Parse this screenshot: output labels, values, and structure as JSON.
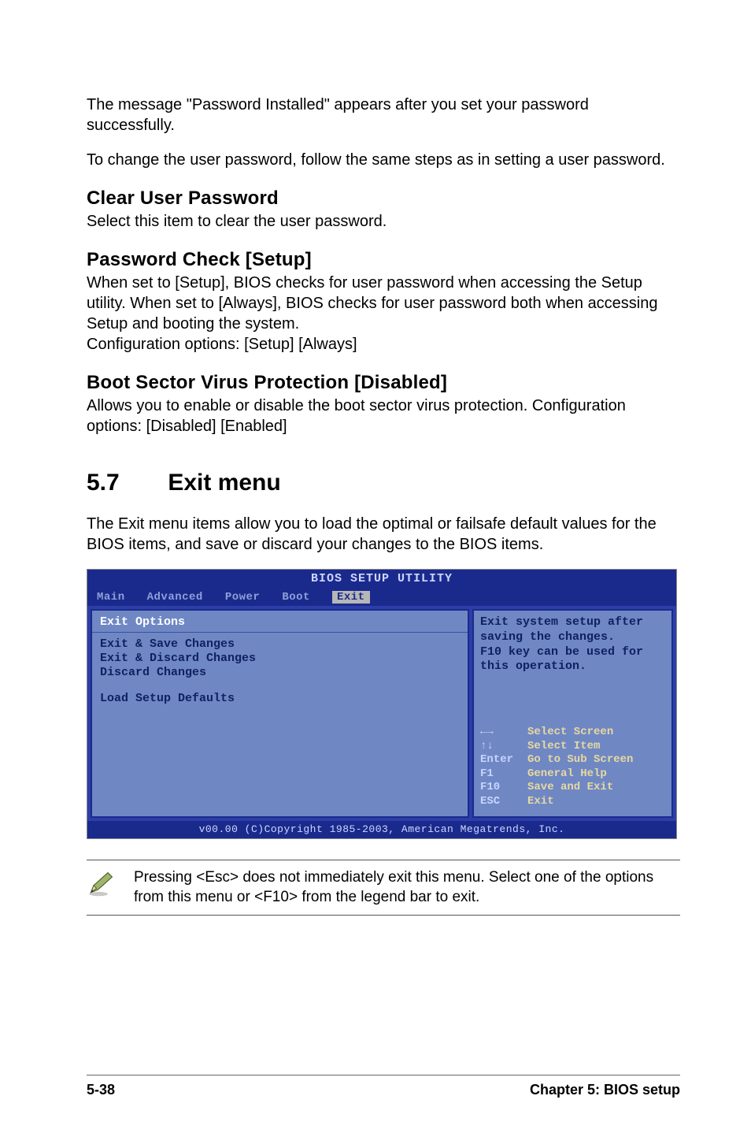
{
  "paragraphs": {
    "p1": "The message \"Password Installed\" appears after you set your password successfully.",
    "p2": "To change the user password, follow the same steps as in setting a user password."
  },
  "sections": {
    "clear_user_password": {
      "heading": "Clear User Password",
      "body": "Select this item to clear the user password."
    },
    "password_check": {
      "heading": "Password Check [Setup]",
      "body": "When set to [Setup], BIOS checks for user password when accessing the Setup utility. When set to [Always], BIOS checks for user password both when accessing Setup and booting the system.\nConfiguration options: [Setup] [Always]"
    },
    "boot_sector": {
      "heading": "Boot Sector Virus Protection [Disabled]",
      "body": "Allows you to enable or disable the boot sector virus protection. Configuration options: [Disabled] [Enabled]"
    }
  },
  "exit_section": {
    "number": "5.7",
    "title": "Exit menu",
    "intro": "The Exit menu items allow you to load the optimal or failsafe default values for the BIOS items, and save or discard your changes to the BIOS items."
  },
  "bios": {
    "title": "BIOS SETUP UTILITY",
    "tabs": [
      "Main",
      "Advanced",
      "Power",
      "Boot",
      "Exit"
    ],
    "active_tab": "Exit",
    "left_title": "Exit Options",
    "items": [
      "Exit & Save Changes",
      "Exit & Discard Changes",
      "Discard Changes",
      "",
      "Load Setup Defaults"
    ],
    "help_text": "Exit system setup after saving the changes.\nF10 key can be used for this operation.",
    "legend": [
      {
        "key": "←→",
        "label": "Select Screen"
      },
      {
        "key": "↑↓",
        "label": "Select Item"
      },
      {
        "key": "Enter",
        "label": "Go to Sub Screen"
      },
      {
        "key": "F1",
        "label": "General Help"
      },
      {
        "key": "F10",
        "label": "Save and Exit"
      },
      {
        "key": "ESC",
        "label": "Exit"
      }
    ],
    "footer": "v00.00 (C)Copyright 1985-2003, American Megatrends, Inc."
  },
  "note": "Pressing <Esc> does not immediately exit this menu. Select one of the options from this menu or <F10> from the legend bar to exit.",
  "page_footer": {
    "left": "5-38",
    "right": "Chapter 5: BIOS setup"
  }
}
